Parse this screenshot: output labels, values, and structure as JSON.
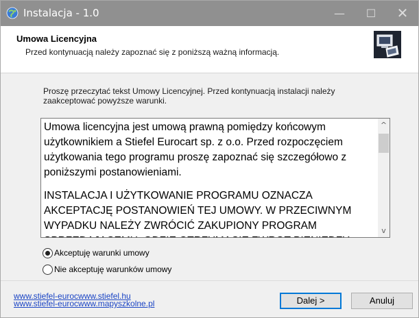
{
  "window": {
    "title": "Instalacja - 1.0",
    "controls": {
      "minimize": "—",
      "maximize": "☐",
      "close": "✕"
    }
  },
  "header": {
    "title": "Umowa Licencyjna",
    "subtitle": "Przed kontynuacją należy zapoznać się z poniższą ważną informacją.",
    "logo_icon": "computer-box-icon"
  },
  "intro": "Proszę przeczytać tekst Umowy Licencyjnej. Przed kontynuacją instalacji należy zaakceptować powyższe warunki.",
  "license": {
    "paragraph1": "Umowa  licencyjna  jest umową prawną pomiędzy końcowym użytkownikiem a Stiefel Eurocart sp. z o.o. Przed rozpoczęciem użytkowania tego programu proszę  zapoznać się szczegółowo z poniższymi postanowieniami.",
    "paragraph2": "INSTALACJA I UŻYTKOWANIE PROGRAMU OZNACZA AKCEPTACJĘ POSTANOWIEŃ TEJ UMOWY. W PRZECIWNYM WYPADKU NALEŻY ZWRÓCIĆ ZAKUPIONY PROGRAM SPRZEDAJĄCEMU, GDZIE OTRZYMACIE ZWROT PIENIĘDZY."
  },
  "options": {
    "accept_label": "Akceptuję warunki umowy",
    "decline_label": "Nie akceptuję warunków umowy",
    "selected": "accept"
  },
  "footer": {
    "link1": "www.stiefel-eurocwww.stiefel.hu",
    "link2": "www.stiefel-eurocwww.mapyszkolne.pl",
    "next_label": "Dalej >",
    "cancel_label": "Anuluj"
  },
  "colors": {
    "titlebar": "#909090",
    "link": "#1a44c4",
    "focus_border": "#0078d7"
  }
}
